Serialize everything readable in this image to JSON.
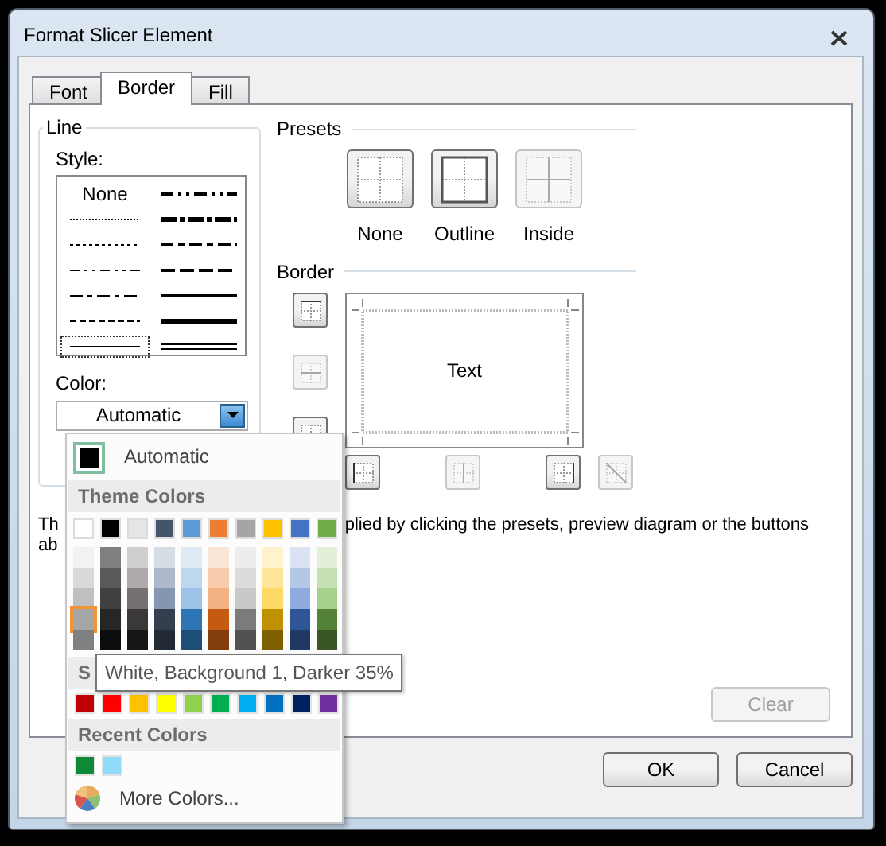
{
  "window": {
    "title": "Format Slicer Element"
  },
  "tabs": [
    {
      "label": "Font",
      "selected": false
    },
    {
      "label": "Border",
      "selected": true
    },
    {
      "label": "Fill",
      "selected": false
    }
  ],
  "line": {
    "heading": "Line",
    "style_label": "Style:",
    "styles": [
      {
        "kind": "none",
        "label": "None",
        "selected": false
      },
      {
        "kind": "hair",
        "selected": false
      },
      {
        "kind": "dotted",
        "selected": false
      },
      {
        "kind": "dash-dot-dot",
        "selected": false
      },
      {
        "kind": "dash-dot",
        "selected": false
      },
      {
        "kind": "dashed",
        "selected": false
      },
      {
        "kind": "thin",
        "selected": true
      },
      {
        "kind": "medium-dash-dot-dot",
        "selected": false
      },
      {
        "kind": "slant-dash-dot",
        "selected": false
      },
      {
        "kind": "medium-dash-dot",
        "selected": false
      },
      {
        "kind": "medium-dashed",
        "selected": false
      },
      {
        "kind": "medium",
        "selected": false
      },
      {
        "kind": "thick",
        "selected": false
      },
      {
        "kind": "double",
        "selected": false
      }
    ],
    "color_label": "Color:",
    "color_value": "Automatic",
    "color_expanded": true
  },
  "presets": {
    "heading": "Presets",
    "items": [
      {
        "kind": "none",
        "label": "None",
        "disabled": false
      },
      {
        "kind": "outline",
        "label": "Outline",
        "disabled": false
      },
      {
        "kind": "inside",
        "label": "Inside",
        "disabled": true
      }
    ]
  },
  "border": {
    "heading": "Border",
    "preview_text": "Text",
    "side_buttons": [
      {
        "kind": "top",
        "disabled": false
      },
      {
        "kind": "middle",
        "disabled": true
      },
      {
        "kind": "bottom",
        "disabled": false
      }
    ],
    "bottom_buttons": [
      {
        "kind": "left",
        "disabled": false
      },
      {
        "kind": "center",
        "disabled": true
      },
      {
        "kind": "right",
        "disabled": false
      },
      {
        "kind": "diagonal",
        "disabled": true
      }
    ]
  },
  "description": {
    "line_1_start": "Th",
    "line_1_end": "plied by clicking the presets, preview diagram or the buttons",
    "line_2_start": "ab"
  },
  "clear_button": {
    "label": "Clear",
    "disabled": true
  },
  "footer_buttons": [
    {
      "label": "OK"
    },
    {
      "label": "Cancel"
    }
  ],
  "color_menu": {
    "automatic_label": "Automatic",
    "theme_heading": "Theme Colors",
    "theme_columns": [
      {
        "color": "#ffffff",
        "selected": false,
        "shades": [
          {
            "color": "#f2f2f2",
            "selected": false
          },
          {
            "color": "#d9d9d9",
            "selected": false
          },
          {
            "color": "#bfbfbf",
            "selected": false
          },
          {
            "color": "#a6a6a6",
            "selected": true
          },
          {
            "color": "#808080",
            "selected": false
          }
        ]
      },
      {
        "color": "#000000",
        "selected": false,
        "shades": [
          {
            "color": "#7f7f7f",
            "selected": false
          },
          {
            "color": "#595959",
            "selected": false
          },
          {
            "color": "#404040",
            "selected": false
          },
          {
            "color": "#262626",
            "selected": false
          },
          {
            "color": "#0d0d0d",
            "selected": false
          }
        ]
      },
      {
        "color": "#e7e6e6",
        "selected": false,
        "shades": [
          {
            "color": "#d0cece",
            "selected": false
          },
          {
            "color": "#aeaaaa",
            "selected": false
          },
          {
            "color": "#757171",
            "selected": false
          },
          {
            "color": "#3b3838",
            "selected": false
          },
          {
            "color": "#171616",
            "selected": false
          }
        ]
      },
      {
        "color": "#44546a",
        "selected": false,
        "shades": [
          {
            "color": "#d6dce4",
            "selected": false
          },
          {
            "color": "#adb9ca",
            "selected": false
          },
          {
            "color": "#8497b0",
            "selected": false
          },
          {
            "color": "#333f4f",
            "selected": false
          },
          {
            "color": "#222a35",
            "selected": false
          }
        ]
      },
      {
        "color": "#5b9bd5",
        "selected": false,
        "shades": [
          {
            "color": "#deebf6",
            "selected": false
          },
          {
            "color": "#bdd7ee",
            "selected": false
          },
          {
            "color": "#9dc3e6",
            "selected": false
          },
          {
            "color": "#2e75b5",
            "selected": false
          },
          {
            "color": "#1f4e79",
            "selected": false
          }
        ]
      },
      {
        "color": "#ed7d31",
        "selected": false,
        "shades": [
          {
            "color": "#fbe5d5",
            "selected": false
          },
          {
            "color": "#f8cbad",
            "selected": false
          },
          {
            "color": "#f4b183",
            "selected": false
          },
          {
            "color": "#c55a11",
            "selected": false
          },
          {
            "color": "#833c0b",
            "selected": false
          }
        ]
      },
      {
        "color": "#a5a5a5",
        "selected": false,
        "shades": [
          {
            "color": "#ededed",
            "selected": false
          },
          {
            "color": "#dbdbdb",
            "selected": false
          },
          {
            "color": "#c9c9c9",
            "selected": false
          },
          {
            "color": "#7b7b7b",
            "selected": false
          },
          {
            "color": "#525252",
            "selected": false
          }
        ]
      },
      {
        "color": "#ffc000",
        "selected": false,
        "shades": [
          {
            "color": "#fff2cc",
            "selected": false
          },
          {
            "color": "#fee599",
            "selected": false
          },
          {
            "color": "#ffd965",
            "selected": false
          },
          {
            "color": "#bf9000",
            "selected": false
          },
          {
            "color": "#7f6000",
            "selected": false
          }
        ]
      },
      {
        "color": "#4472c4",
        "selected": false,
        "shades": [
          {
            "color": "#dae3f3",
            "selected": false
          },
          {
            "color": "#b4c7e7",
            "selected": false
          },
          {
            "color": "#8faadc",
            "selected": false
          },
          {
            "color": "#2f5597",
            "selected": false
          },
          {
            "color": "#1f3864",
            "selected": false
          }
        ]
      },
      {
        "color": "#70ad47",
        "selected": false,
        "shades": [
          {
            "color": "#e2efd9",
            "selected": false
          },
          {
            "color": "#c5e0b3",
            "selected": false
          },
          {
            "color": "#a8d08d",
            "selected": false
          },
          {
            "color": "#538135",
            "selected": false
          },
          {
            "color": "#375623",
            "selected": false
          }
        ]
      }
    ],
    "standard_heading": "S",
    "standard_colors": [
      {
        "color": "#c00000",
        "selected": false
      },
      {
        "color": "#ff0000",
        "selected": false
      },
      {
        "color": "#ffc000",
        "selected": false
      },
      {
        "color": "#ffff00",
        "selected": false
      },
      {
        "color": "#92d050",
        "selected": false
      },
      {
        "color": "#00b050",
        "selected": false
      },
      {
        "color": "#00b0f0",
        "selected": false
      },
      {
        "color": "#0070c0",
        "selected": false
      },
      {
        "color": "#002060",
        "selected": false
      },
      {
        "color": "#7030a0",
        "selected": false
      }
    ],
    "recent_heading": "Recent Colors",
    "recent_colors": [
      {
        "color": "#0e8a36",
        "selected": false
      },
      {
        "color": "#92dcfb",
        "selected": false
      }
    ],
    "more_label": "More Colors..."
  },
  "tooltip": "White, Background 1, Darker 35%"
}
